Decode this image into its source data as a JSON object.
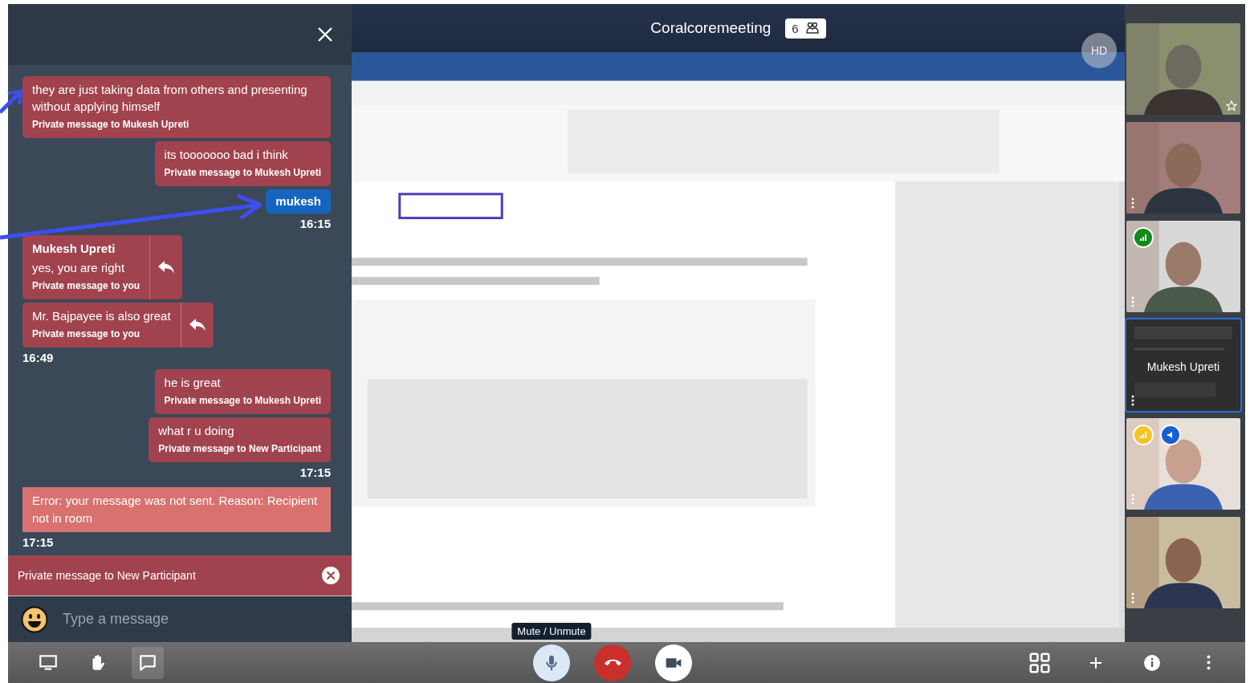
{
  "chat": {
    "messages": [
      {
        "kind": "private_out",
        "text": "they are just taking data from others and presenting without applying himself",
        "note": "Private message to Mukesh Upreti"
      },
      {
        "kind": "private_out",
        "text": "its tooooooo bad i think",
        "note": "Private message to Mukesh Upreti"
      },
      {
        "kind": "public_out",
        "text": "mukesh"
      },
      {
        "kind": "time_right",
        "text": "16:15"
      },
      {
        "kind": "private_in",
        "sender": "Mukesh Upreti",
        "text": "yes, you are right",
        "note": "Private message to you"
      },
      {
        "kind": "private_in",
        "text": "Mr. Bajpayee is also great",
        "note": "Private message to you"
      },
      {
        "kind": "time_left",
        "text": "16:49"
      },
      {
        "kind": "private_out",
        "text": "he is great",
        "note": "Private message to Mukesh Upreti"
      },
      {
        "kind": "private_out",
        "text": "what r u doing",
        "note": "Private message to New Participant"
      },
      {
        "kind": "time_right",
        "text": "17:15"
      },
      {
        "kind": "error",
        "text": "Error: your message was not sent. Reason: Recipient not in room"
      },
      {
        "kind": "time_left",
        "text": "17:15"
      }
    ],
    "private_target": "Private message to New Participant",
    "input": {
      "placeholder": "Type a message"
    }
  },
  "meeting": {
    "title": "Coralcoremeeting",
    "participant_count": "6",
    "quality_badge": "HD"
  },
  "thumbnails": [
    {
      "kind": "camera",
      "selected": false,
      "star": true,
      "menu": false
    },
    {
      "kind": "camera",
      "selected": false,
      "star": false,
      "menu": true
    },
    {
      "kind": "camera",
      "selected": false,
      "star": false,
      "menu": true,
      "indicators": [
        {
          "kind": "signal",
          "color": "#138a1c"
        }
      ]
    },
    {
      "kind": "screen",
      "name": "Mukesh Upreti",
      "selected": true,
      "star": false,
      "menu": true
    },
    {
      "kind": "camera",
      "selected": false,
      "star": false,
      "menu": true,
      "indicators": [
        {
          "kind": "signal",
          "color": "#f5c32c"
        },
        {
          "kind": "speaker",
          "color": "#1a5fd1"
        }
      ]
    },
    {
      "kind": "camera",
      "selected": false,
      "star": false,
      "menu": true
    }
  ],
  "toolbar": {
    "left": [
      {
        "kind": "screen",
        "toggled": false
      },
      {
        "kind": "hand",
        "toggled": false
      },
      {
        "kind": "chat",
        "toggled": true
      }
    ],
    "center": [
      {
        "kind": "mic",
        "tooltip": "Mute / Unmute"
      },
      {
        "kind": "hangup"
      },
      {
        "kind": "camera"
      }
    ],
    "right": [
      {
        "kind": "grid"
      },
      {
        "kind": "plus"
      },
      {
        "kind": "info"
      },
      {
        "kind": "more"
      }
    ]
  }
}
